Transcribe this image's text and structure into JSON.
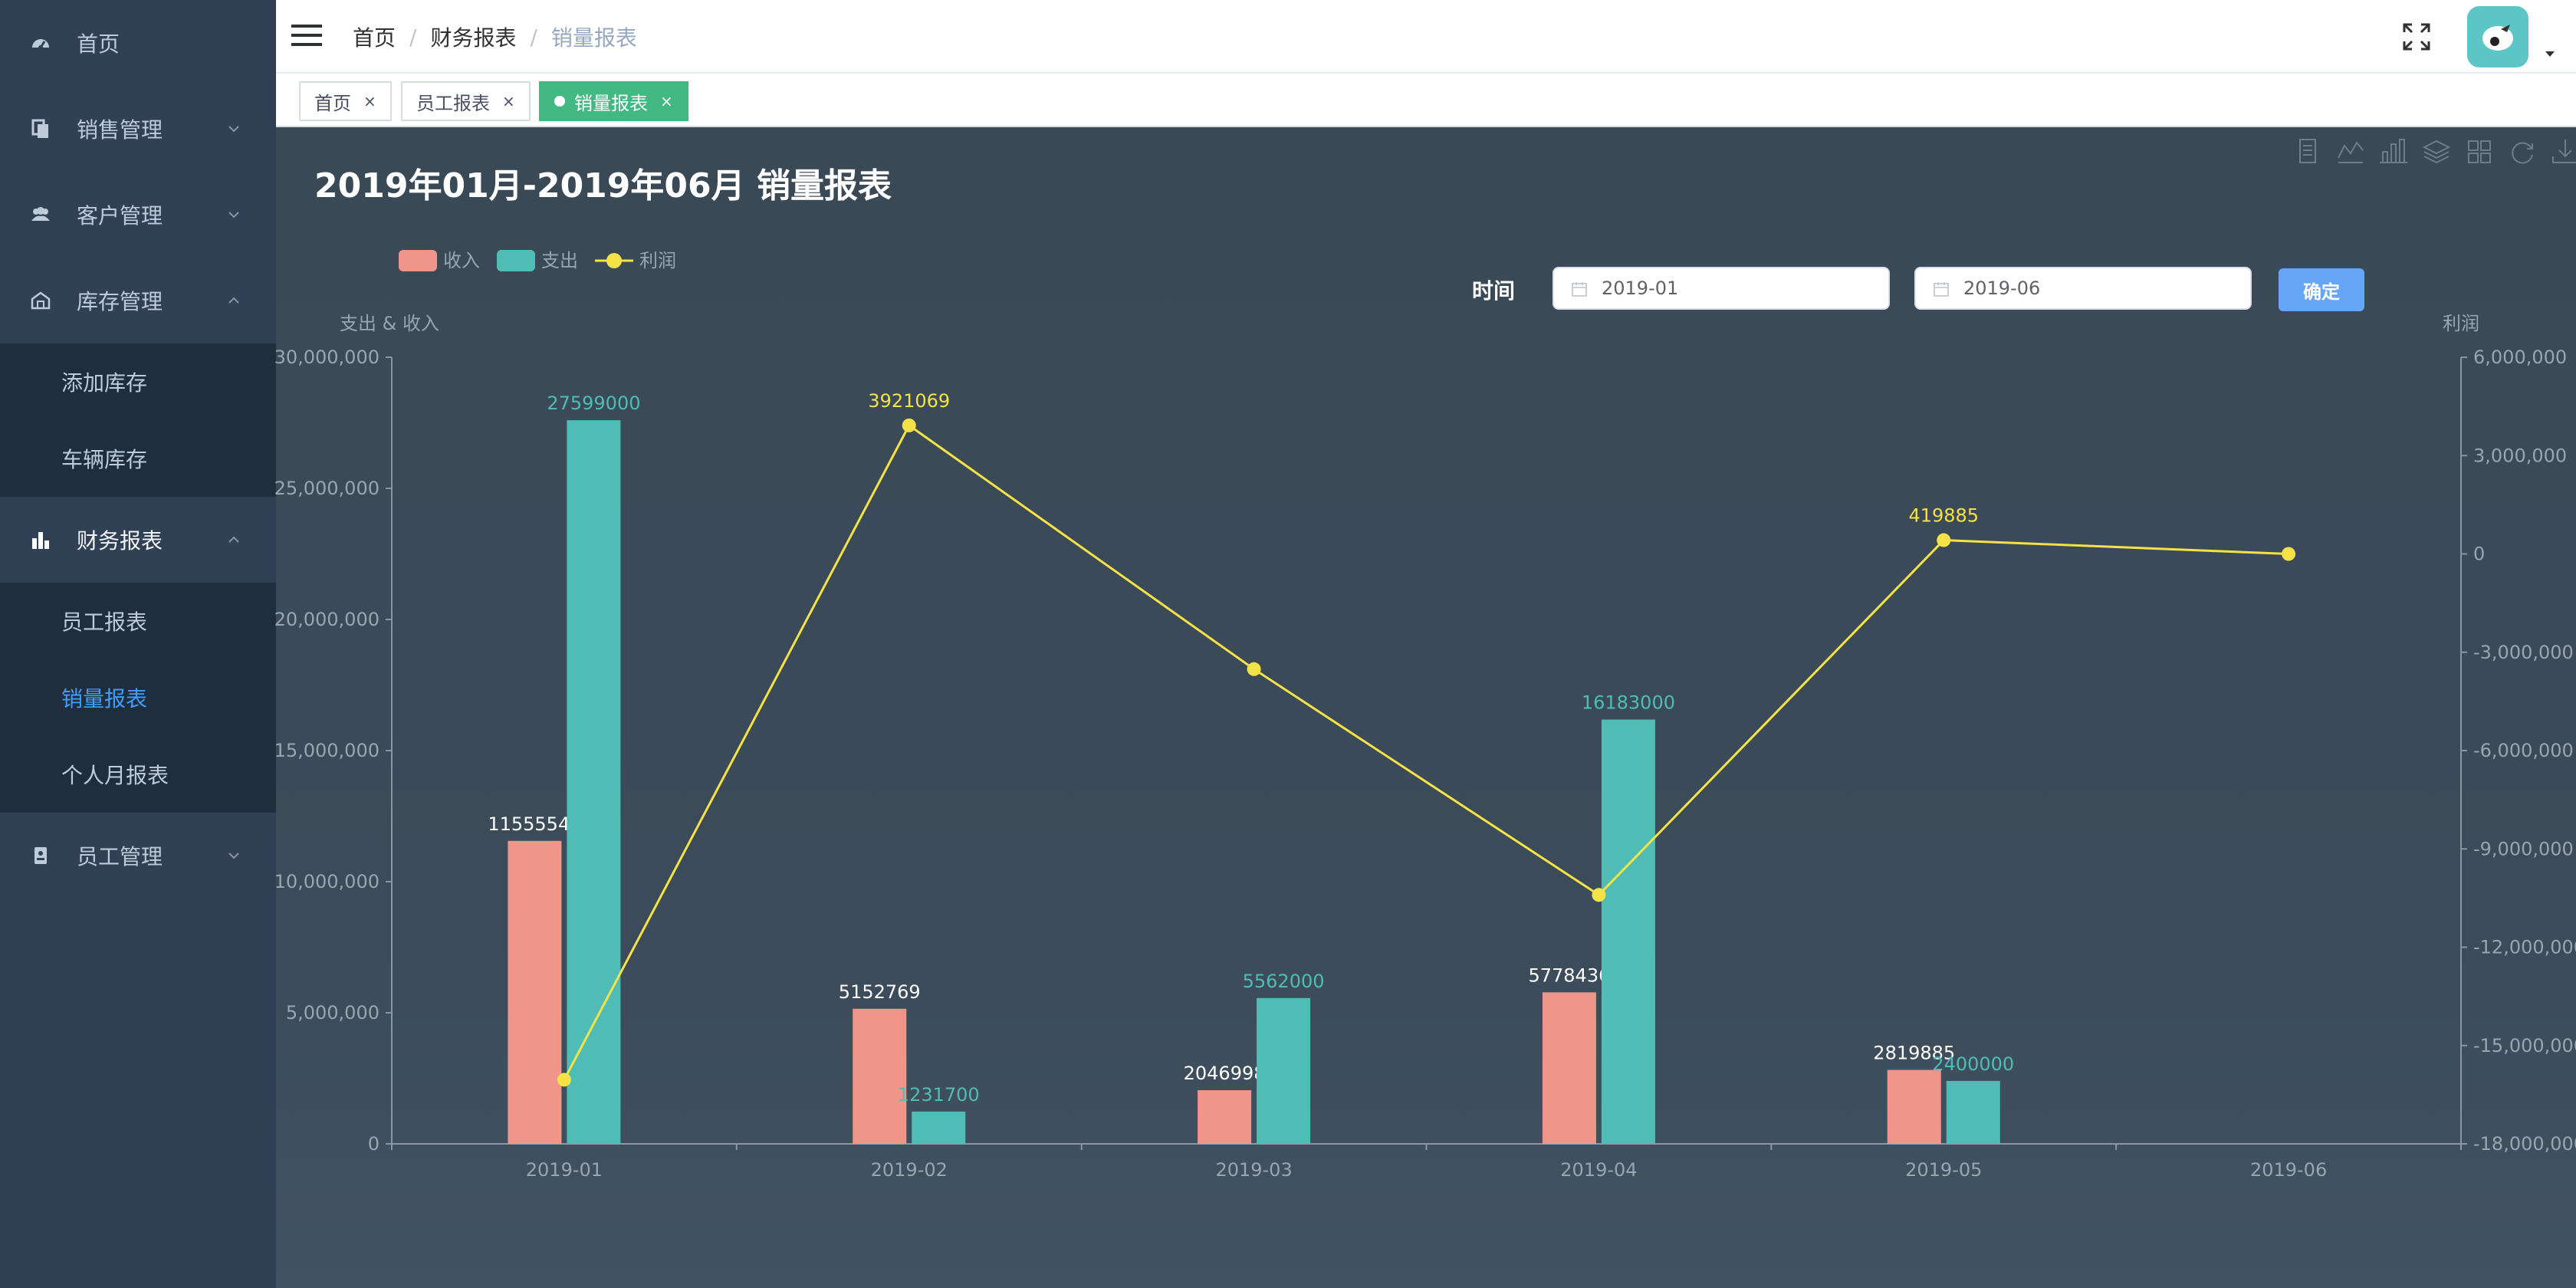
{
  "sidebar": {
    "items": [
      {
        "label": "首页",
        "icon": "dashboard-icon"
      },
      {
        "label": "销售管理",
        "icon": "document-icon"
      },
      {
        "label": "客户管理",
        "icon": "peoples-icon"
      },
      {
        "label": "库存管理",
        "icon": "warehouse-icon"
      },
      {
        "label": "财务报表",
        "icon": "chart-icon"
      },
      {
        "label": "员工管理",
        "icon": "badge-icon"
      }
    ],
    "inventory_sub": [
      "添加库存",
      "车辆库存"
    ],
    "finance_sub": [
      "员工报表",
      "销量报表",
      "个人月报表"
    ]
  },
  "navbar": {
    "breadcrumb": [
      "首页",
      "财务报表",
      "销量报表"
    ],
    "separator": "/"
  },
  "tags": [
    {
      "label": "首页",
      "close": "×"
    },
    {
      "label": "员工报表",
      "close": "×"
    },
    {
      "label": "销量报表",
      "close": "×"
    }
  ],
  "page": {
    "title": "2019年01月-2019年06月 销量报表",
    "time_label": "时间",
    "start_date": "2019-01",
    "end_date": "2019-06",
    "confirm_label": "确定"
  },
  "colors": {
    "income": "#f0958a",
    "expense": "#4fbdb5",
    "profit": "#f5e246",
    "active_tag": "#42b983",
    "active_menu": "#409eff"
  },
  "chart_data": {
    "type": "bar",
    "categories": [
      "2019-01",
      "2019-02",
      "2019-03",
      "2019-04",
      "2019-05",
      "2019-06"
    ],
    "series": [
      {
        "name": "收入",
        "type": "bar",
        "values": [
          11555544,
          5152769,
          2046998,
          5778436,
          2819885,
          null
        ],
        "labels": [
          "11555544",
          "5152769",
          "2046998",
          "5778436",
          "2819885",
          ""
        ]
      },
      {
        "name": "支出",
        "type": "bar",
        "values": [
          27599000,
          1231700,
          5562000,
          16183000,
          2400000,
          null
        ],
        "labels": [
          "27599000",
          "1231700",
          "5562000",
          "16183000",
          "2400000",
          ""
        ]
      },
      {
        "name": "利润",
        "type": "line",
        "axis": "right",
        "values": [
          -16043456,
          3921069,
          -3515002,
          -10404564,
          419885,
          0
        ],
        "labels": [
          "",
          "3921069",
          "",
          "",
          "419885",
          ""
        ]
      }
    ],
    "ylabel_left": "支出 & 收入",
    "ylabel_right": "利润",
    "ylim_left": [
      0,
      30000000
    ],
    "ylim_right": [
      -18000000,
      6000000
    ],
    "yticks_left": [
      "0",
      "5,000,000",
      "10,000,000",
      "15,000,000",
      "20,000,000",
      "25,000,000",
      "30,000,000"
    ],
    "yticks_right": [
      "-18,000,000",
      "-15,000,000",
      "-12,000,000",
      "-9,000,000",
      "-6,000,000",
      "-3,000,000",
      "0",
      "3,000,000",
      "6,000,000"
    ],
    "legend_position": "top-left",
    "grid": false
  }
}
